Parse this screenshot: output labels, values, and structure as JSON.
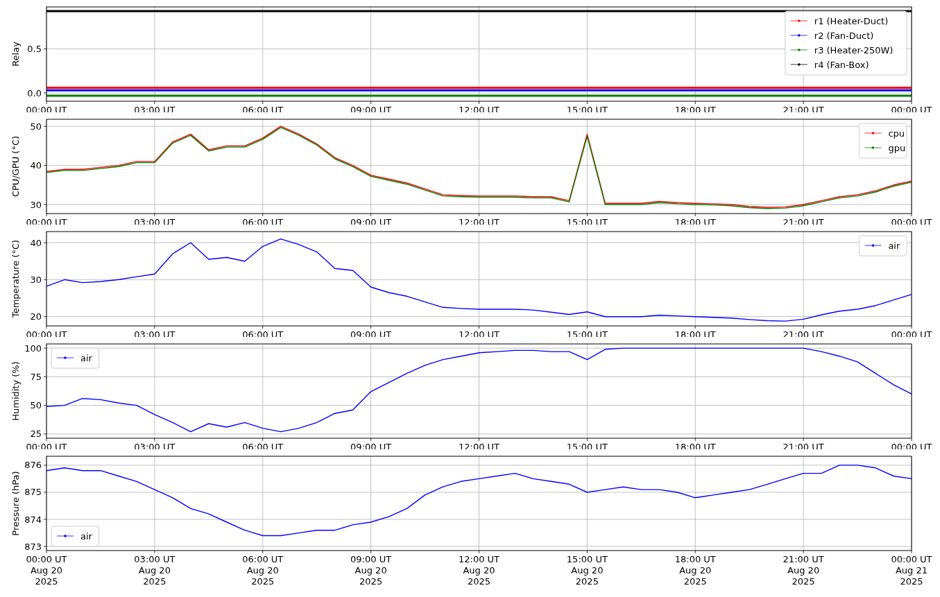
{
  "panels": [
    {
      "chart_data": {
        "type": "line",
        "grid": true,
        "legend": "upper right",
        "ylabel": "Relay",
        "ylim": [
          -0.094,
          0.977
        ],
        "categories": [
          "00:00 UT",
          "03:00 UT",
          "06:00 UT",
          "09:00 UT",
          "12:00 UT",
          "15:00 UT",
          "18:00 UT",
          "21:00 UT",
          "00:00 UT"
        ],
        "yticks": [
          {
            "value": 0,
            "label": "0.0"
          },
          {
            "value": 0.5,
            "label": "0.5"
          }
        ],
        "series": [
          {
            "name": "r1 (Heater-Duct)",
            "color": "#ff0000",
            "values": [
              0.06,
              0.06,
              0.06,
              0.06,
              0.06,
              0.06,
              0.06,
              0.06,
              0.06
            ]
          },
          {
            "name": "r2 (Fan-Duct)",
            "color": "#0000ff",
            "values": [
              0.03,
              0.03,
              0.03,
              0.03,
              0.03,
              0.03,
              0.03,
              0.03,
              0.03
            ]
          },
          {
            "name": "r3 (Heater-250W)",
            "color": "#008000",
            "values": [
              -0.03,
              -0.03,
              -0.03,
              -0.03,
              -0.03,
              -0.03,
              -0.03,
              -0.03,
              -0.03
            ]
          },
          {
            "name": "r4 (Fan-Box)",
            "color": "#000000",
            "values": [
              0.93,
              0.93,
              0.93,
              0.93,
              0.93,
              0.93,
              0.93,
              0.93,
              0.93
            ]
          }
        ]
      }
    },
    {
      "chart_data": {
        "type": "line",
        "grid": true,
        "legend": "upper right",
        "ylabel": "CPU/GPU (°C)",
        "ylim": [
          27.7,
          51.8
        ],
        "categories": [
          "00:00 UT",
          null,
          null,
          null,
          null,
          null,
          "03:00 UT",
          null,
          null,
          null,
          null,
          null,
          "06:00 UT",
          null,
          null,
          null,
          null,
          null,
          "09:00 UT",
          null,
          null,
          null,
          null,
          null,
          "12:00 UT",
          null,
          null,
          null,
          null,
          null,
          "15:00 UT",
          null,
          null,
          null,
          null,
          null,
          "18:00 UT",
          null,
          null,
          null,
          null,
          null,
          "21:00 UT",
          null,
          null,
          null,
          null,
          null,
          "00:00 UT"
        ],
        "yticks": [
          30,
          40,
          50
        ],
        "series": [
          {
            "name": "cpu",
            "color": "#ff0000",
            "values": [
              38.5,
              39,
              39,
              39.5,
              40,
              41,
              41,
              46,
              48,
              44,
              45,
              45,
              47,
              50,
              48,
              45.5,
              42,
              40,
              37.5,
              36.5,
              35.5,
              34,
              32.5,
              32.3,
              32.2,
              32.2,
              32.2,
              32,
              32,
              31,
              48,
              30.3,
              30.3,
              30.3,
              30.8,
              30.5,
              30.3,
              30.2,
              30,
              29.5,
              29.3,
              29.4,
              30,
              31,
              32,
              32.5,
              33.5,
              35,
              36
            ]
          },
          {
            "name": "gpu",
            "color": "#008000",
            "values": [
              38.2,
              38.7,
              38.7,
              39.2,
              39.7,
              40.7,
              40.7,
              45.7,
              47.7,
              43.7,
              44.7,
              44.7,
              46.7,
              49.7,
              47.7,
              45.2,
              41.7,
              39.7,
              37.2,
              36.2,
              35.2,
              33.7,
              32.2,
              32.0,
              31.9,
              31.9,
              31.9,
              31.7,
              31.7,
              30.7,
              47.5,
              30.0,
              30.0,
              30.0,
              30.5,
              30.2,
              30.0,
              29.9,
              29.7,
              29.2,
              29.0,
              29.1,
              29.7,
              30.7,
              31.7,
              32.2,
              33.2,
              34.7,
              35.7
            ]
          }
        ]
      }
    },
    {
      "chart_data": {
        "type": "line",
        "grid": true,
        "legend": "upper right",
        "ylabel": "Temperature (°C)",
        "ylim": [
          17.5,
          43.0
        ],
        "categories": [
          "00:00 UT",
          null,
          null,
          null,
          null,
          null,
          "03:00 UT",
          null,
          null,
          null,
          null,
          null,
          "06:00 UT",
          null,
          null,
          null,
          null,
          null,
          "09:00 UT",
          null,
          null,
          null,
          null,
          null,
          "12:00 UT",
          null,
          null,
          null,
          null,
          null,
          "15:00 UT",
          null,
          null,
          null,
          null,
          null,
          "18:00 UT",
          null,
          null,
          null,
          null,
          null,
          "21:00 UT",
          null,
          null,
          null,
          null,
          null,
          "00:00 UT"
        ],
        "yticks": [
          20,
          30,
          40
        ],
        "series": [
          {
            "name": "air",
            "color": "#0000ff",
            "values": [
              28.2,
              30.0,
              29.2,
              29.5,
              30.0,
              30.8,
              31.5,
              37,
              40,
              35.5,
              36,
              35,
              39,
              41,
              39.5,
              37.5,
              33,
              32.5,
              28,
              26.5,
              25.5,
              24,
              22.5,
              22.2,
              22,
              22,
              22,
              21.8,
              21.2,
              20.6,
              21.3,
              20,
              20,
              20,
              20.4,
              20.2,
              20,
              19.8,
              19.6,
              19.2,
              18.9,
              18.8,
              19.3,
              20.5,
              21.5,
              22,
              23,
              24.5,
              26
            ]
          }
        ]
      }
    },
    {
      "chart_data": {
        "type": "line",
        "grid": true,
        "legend": "upper left",
        "ylabel": "Humidity (%)",
        "ylim": [
          21.3,
          103.7
        ],
        "categories": [
          "00:00 UT",
          null,
          null,
          null,
          null,
          null,
          "03:00 UT",
          null,
          null,
          null,
          null,
          null,
          "06:00 UT",
          null,
          null,
          null,
          null,
          null,
          "09:00 UT",
          null,
          null,
          null,
          null,
          null,
          "12:00 UT",
          null,
          null,
          null,
          null,
          null,
          "15:00 UT",
          null,
          null,
          null,
          null,
          null,
          "18:00 UT",
          null,
          null,
          null,
          null,
          null,
          "21:00 UT",
          null,
          null,
          null,
          null,
          null,
          "00:00 UT"
        ],
        "yticks": [
          25,
          50,
          75,
          100
        ],
        "series": [
          {
            "name": "air",
            "color": "#0000ff",
            "values": [
              49,
              50,
              56,
              55,
              52,
              50,
              42,
              35,
              27,
              34,
              31,
              35,
              30,
              27,
              30,
              35,
              43,
              46,
              62,
              70,
              78,
              85,
              90,
              93,
              96,
              97,
              98,
              98,
              97,
              97,
              90,
              99,
              100,
              100,
              100,
              100,
              100,
              100,
              100,
              100,
              100,
              100,
              100,
              97,
              93,
              88,
              78,
              68,
              60
            ]
          }
        ]
      }
    },
    {
      "chart_data": {
        "type": "line",
        "grid": true,
        "legend": "lower left",
        "ylabel": "Pressure (hPa)",
        "ylim": [
          872.85,
          876.33
        ],
        "categories": [
          "00:00 UT\nAug 20\n2025",
          null,
          null,
          null,
          null,
          null,
          "03:00 UT\nAug 20\n2025",
          null,
          null,
          null,
          null,
          null,
          "06:00 UT\nAug 20\n2025",
          null,
          null,
          null,
          null,
          null,
          "09:00 UT\nAug 20\n2025",
          null,
          null,
          null,
          null,
          null,
          "12:00 UT\nAug 20\n2025",
          null,
          null,
          null,
          null,
          null,
          "15:00 UT\nAug 20\n2025",
          null,
          null,
          null,
          null,
          null,
          "18:00 UT\nAug 20\n2025",
          null,
          null,
          null,
          null,
          null,
          "21:00 UT\nAug 20\n2025",
          null,
          null,
          null,
          null,
          null,
          "00:00 UT\nAug 21\n2025"
        ],
        "yticks": [
          873,
          874,
          875,
          876
        ],
        "series": [
          {
            "name": "air",
            "color": "#0000ff",
            "values": [
              875.8,
              875.9,
              875.8,
              875.8,
              875.6,
              875.4,
              875.1,
              874.8,
              874.4,
              874.2,
              873.9,
              873.6,
              873.4,
              873.4,
              873.5,
              873.6,
              873.6,
              873.8,
              873.9,
              874.1,
              874.4,
              874.9,
              875.2,
              875.4,
              875.5,
              875.6,
              875.7,
              875.5,
              875.4,
              875.3,
              875.0,
              875.1,
              875.2,
              875.1,
              875.1,
              875.0,
              874.8,
              874.9,
              875.0,
              875.1,
              875.3,
              875.5,
              875.7,
              875.7,
              876.0,
              876.0,
              875.9,
              875.6,
              875.5
            ]
          }
        ]
      }
    }
  ]
}
